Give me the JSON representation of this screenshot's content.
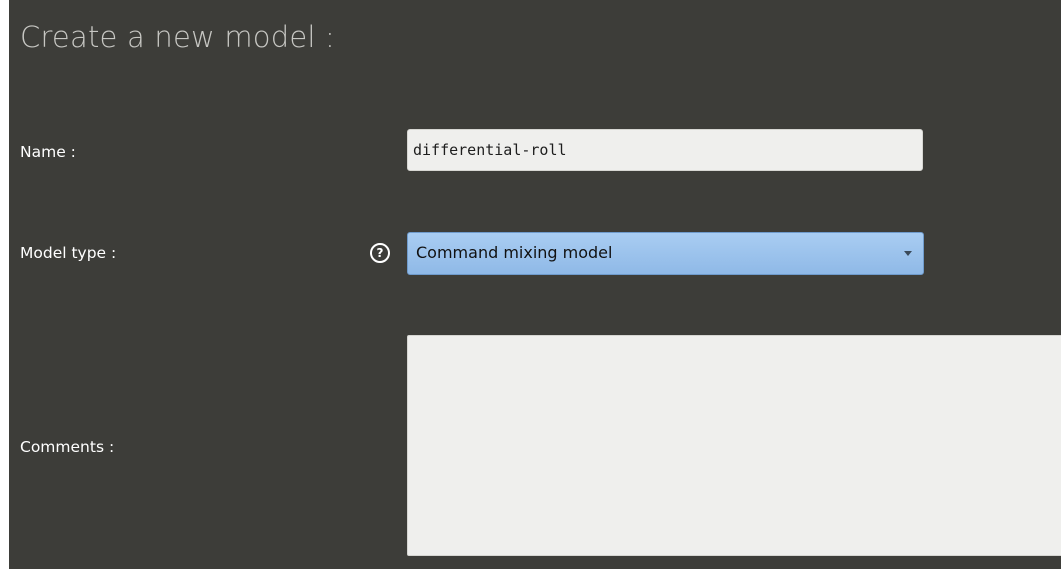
{
  "form": {
    "title": "Create a new model :",
    "name": {
      "label": "Name :",
      "value": "differential-roll"
    },
    "model_type": {
      "label": "Model type :",
      "help_icon": "question-mark-circle-icon",
      "help_glyph": "?",
      "selected": "Command mixing model",
      "arrow_icon": "dropdown-arrow-icon"
    },
    "comments": {
      "label": "Comments :",
      "value": ""
    }
  },
  "colors": {
    "background": "#3d3d39",
    "title_text": "#c7c7c3",
    "input_background": "#efefed",
    "select_highlight": "#9cc3ee"
  }
}
